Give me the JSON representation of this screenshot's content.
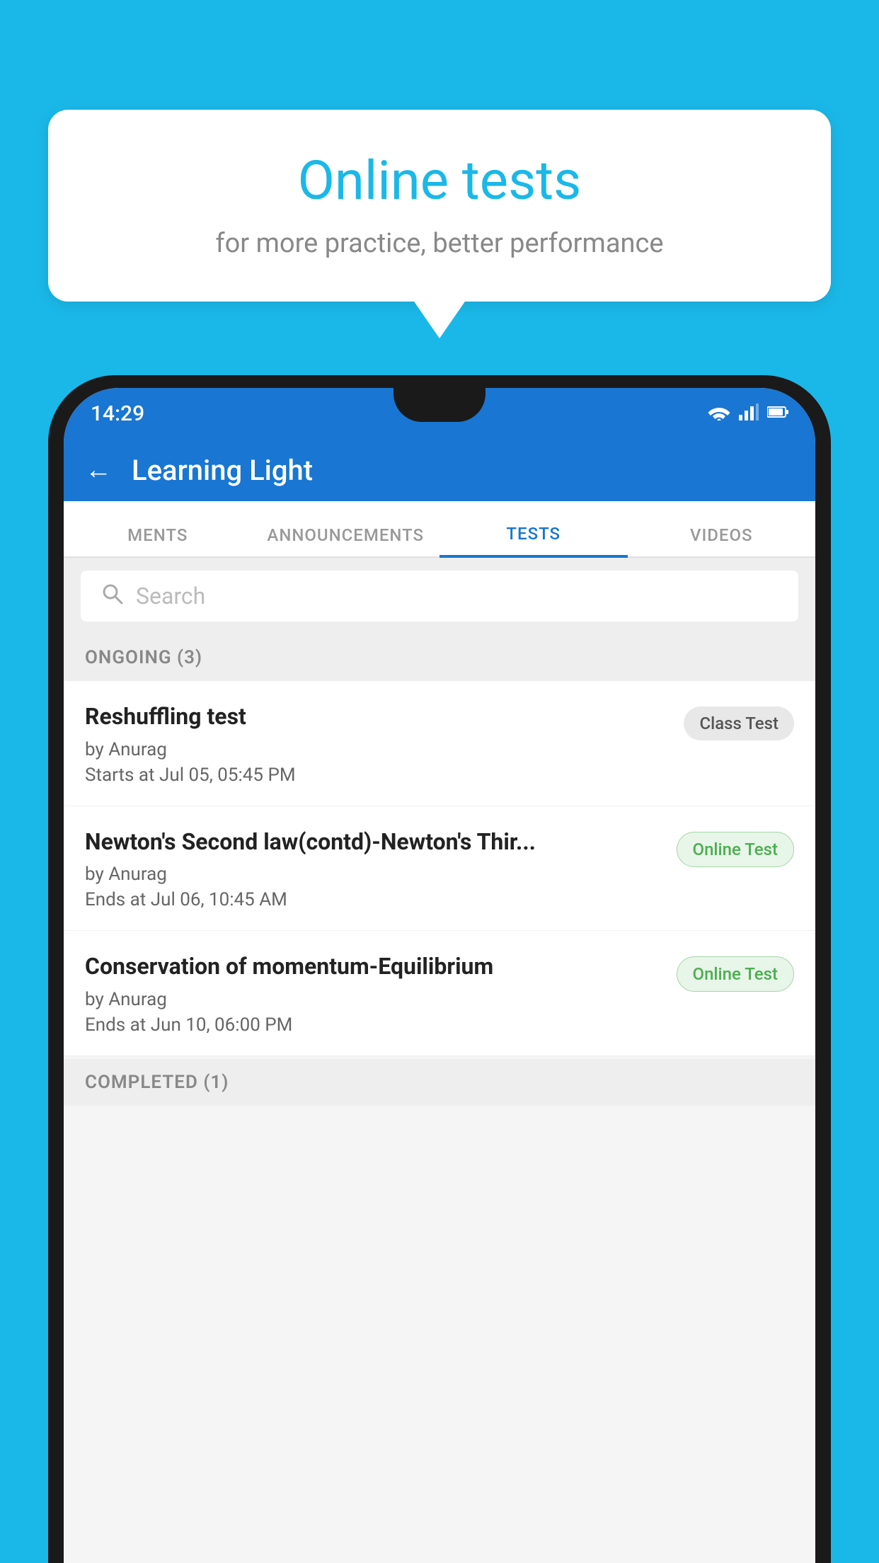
{
  "background_color": "#1ab8e8",
  "speech_bubble": {
    "title": "Online tests",
    "subtitle": "for more practice, better performance"
  },
  "status_bar": {
    "time": "14:29",
    "wifi": "▼",
    "signal": "▲",
    "battery": "▮"
  },
  "app_header": {
    "back_arrow": "←",
    "title": "Learning Light"
  },
  "tabs": [
    {
      "label": "MENTS",
      "active": false
    },
    {
      "label": "ANNOUNCEMENTS",
      "active": false
    },
    {
      "label": "TESTS",
      "active": true
    },
    {
      "label": "VIDEOS",
      "active": false
    }
  ],
  "search": {
    "placeholder": "Search"
  },
  "ongoing_section": {
    "title": "ONGOING (3)"
  },
  "tests": [
    {
      "name": "Reshuffling test",
      "author": "by Anurag",
      "time_label": "Starts at",
      "time": "Jul 05, 05:45 PM",
      "badge": "Class Test",
      "badge_type": "class"
    },
    {
      "name": "Newton's Second law(contd)-Newton's Thir...",
      "author": "by Anurag",
      "time_label": "Ends at",
      "time": "Jul 06, 10:45 AM",
      "badge": "Online Test",
      "badge_type": "online"
    },
    {
      "name": "Conservation of momentum-Equilibrium",
      "author": "by Anurag",
      "time_label": "Ends at",
      "time": "Jun 10, 06:00 PM",
      "badge": "Online Test",
      "badge_type": "online"
    }
  ],
  "completed_section": {
    "title": "COMPLETED (1)"
  }
}
